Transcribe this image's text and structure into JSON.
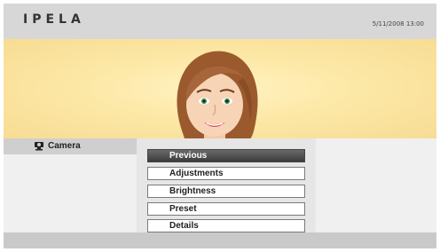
{
  "header": {
    "logo": "IPELA",
    "datetime": "5/11/2008 13:00"
  },
  "left_panel": {
    "tab_label": "Camera",
    "tab_icon": "camera-icon"
  },
  "menu": {
    "items": [
      "Previous",
      "Adjustments",
      "Brightness",
      "Preset",
      "Details"
    ],
    "selected_index": 0
  },
  "colors": {
    "header_bg": "#d7d7d7",
    "banner_bg": "#fde9a8",
    "selected_bg": "#4a4a4a"
  }
}
